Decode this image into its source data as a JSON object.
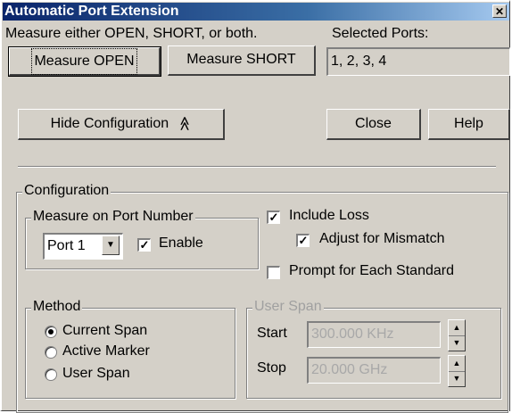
{
  "window": {
    "title": "Automatic Port Extension",
    "close_glyph": "✕"
  },
  "measure": {
    "instruction": "Measure either OPEN, SHORT, or both.",
    "open_button": "Measure OPEN",
    "short_button": "Measure SHORT"
  },
  "ports": {
    "label": "Selected Ports:",
    "value": "1, 2, 3, 4"
  },
  "buttons": {
    "hide_configuration": "Hide  Configuration",
    "hide_icon": "chevron-double-up-icon",
    "hide_glyph": "≪",
    "close": "Close",
    "help": "Help"
  },
  "configuration": {
    "legend": "Configuration",
    "port_group": {
      "legend": "Measure on Port Number",
      "selected_port": "Port 1",
      "enable_label": "Enable",
      "enable_checked": true
    },
    "include_loss": {
      "label": "Include Loss",
      "checked": true
    },
    "adjust_mismatch": {
      "label": "Adjust for Mismatch",
      "checked": true
    },
    "prompt_each": {
      "label": "Prompt for Each Standard",
      "checked": false
    },
    "method": {
      "legend": "Method",
      "options": [
        {
          "label": "Current Span",
          "selected": true
        },
        {
          "label": "Active Marker",
          "selected": false
        },
        {
          "label": "User Span",
          "selected": false
        }
      ]
    },
    "user_span": {
      "legend": "User Span",
      "enabled": false,
      "start_label": "Start",
      "start_value": "300.000 KHz",
      "stop_label": "Stop",
      "stop_value": "20.000 GHz"
    }
  },
  "glyphs": {
    "check": "✓",
    "dropdown": "▼",
    "spin_up": "▲",
    "spin_down": "▼"
  },
  "colors": {
    "title_bar_start": "#0a246a",
    "title_bar_end": "#a6caf0",
    "dialog_face": "#d4d0c8",
    "disabled_text": "#a8a8a8"
  }
}
